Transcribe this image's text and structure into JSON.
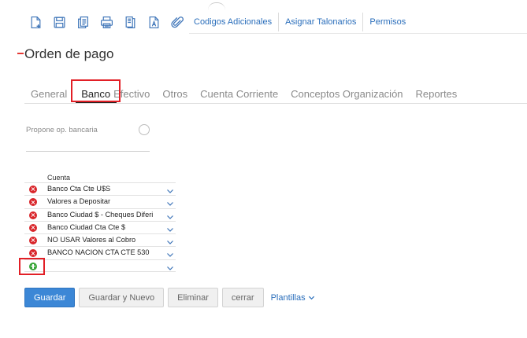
{
  "toolbar": {
    "icons": [
      "new-document-icon",
      "save-icon",
      "copy-icon",
      "print-icon",
      "export-icon",
      "pdf-icon",
      "attach-icon"
    ],
    "links": [
      "Codigos Adicionales",
      "Asignar Talonarios",
      "Permisos"
    ]
  },
  "page": {
    "title": "Orden de pago"
  },
  "tabs": [
    "General",
    "Banco",
    "Efectivo",
    "Otros",
    "Cuenta Corriente",
    "Conceptos Organización",
    "Reportes"
  ],
  "active_tab": "Banco",
  "form": {
    "propone_label": "Propone op. bancaria"
  },
  "grid": {
    "header": "Cuenta",
    "rows": [
      "Banco Cta Cte U$S",
      "Valores a Depositar",
      "Banco Ciudad $ - Cheques Diferi",
      "Banco Ciudad Cta Cte $",
      "NO USAR Valores al Cobro",
      "BANCO NACION CTA CTE 530"
    ]
  },
  "buttons": {
    "save": "Guardar",
    "save_new": "Guardar y Nuevo",
    "delete": "Eliminar",
    "close": "cerrar",
    "templates": "Plantillas"
  },
  "colors": {
    "accent": "#2a6ebb",
    "primary_button": "#3c87d6",
    "delete": "#d9262b",
    "add": "#3aa63a",
    "highlight": "#e21f26"
  }
}
